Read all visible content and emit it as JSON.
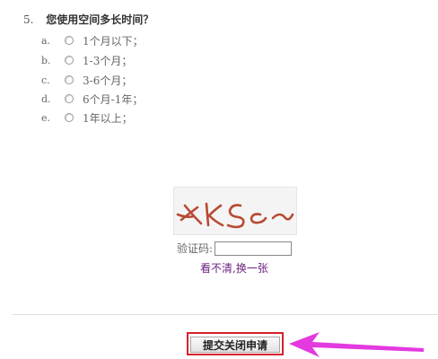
{
  "question": {
    "number": "5.",
    "title": "您使用空间多长时间？",
    "options": [
      {
        "letter": "a.",
        "text": "1个月以下；"
      },
      {
        "letter": "b.",
        "text": "1-3个月；"
      },
      {
        "letter": "c.",
        "text": "3-6个月；"
      },
      {
        "letter": "d.",
        "text": "6个月-1年；"
      },
      {
        "letter": "e.",
        "text": "1年以上；"
      }
    ]
  },
  "captcha": {
    "image_text": "XKSc",
    "label": "验证码:",
    "input_value": "",
    "refresh_link": "看不清,换一张"
  },
  "submit": {
    "label": "提交关闭申请"
  },
  "colors": {
    "highlight": "#d6222a",
    "arrow": "#e33ae0",
    "captcha_ink": "#b84a34",
    "link": "#6a1e7e"
  }
}
